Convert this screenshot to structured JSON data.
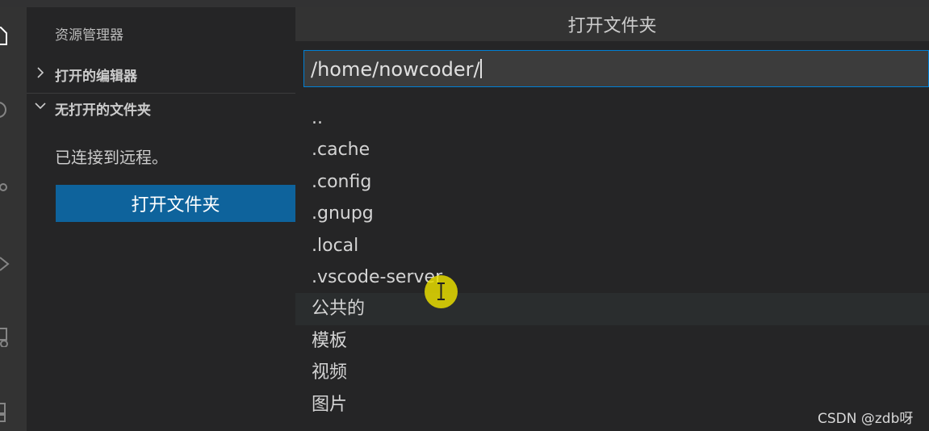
{
  "activity_bar": {
    "icons": [
      "files-icon",
      "search-icon",
      "source-control-icon",
      "run-debug-icon",
      "remote-explorer-icon",
      "extensions-icon"
    ]
  },
  "sidebar": {
    "title": "资源管理器",
    "sections": [
      {
        "label": "打开的编辑器",
        "expanded": false
      },
      {
        "label": "无打开的文件夹",
        "expanded": true
      }
    ],
    "message": "已连接到远程。",
    "open_folder_button": "打开文件夹"
  },
  "quick_open": {
    "title": "打开文件夹",
    "input_value": "/home/nowcoder/",
    "items": [
      "..",
      ".cache",
      ".config",
      ".gnupg",
      ".local",
      ".vscode-server",
      "公共的",
      "模板",
      "视频",
      "图片"
    ],
    "hovered_index": 6
  },
  "watermark": "CSDN @zdb呀",
  "colors": {
    "accent_button": "#0e639c",
    "input_focus_border": "#007fd4",
    "cursor_highlight": "#e6dc00"
  }
}
